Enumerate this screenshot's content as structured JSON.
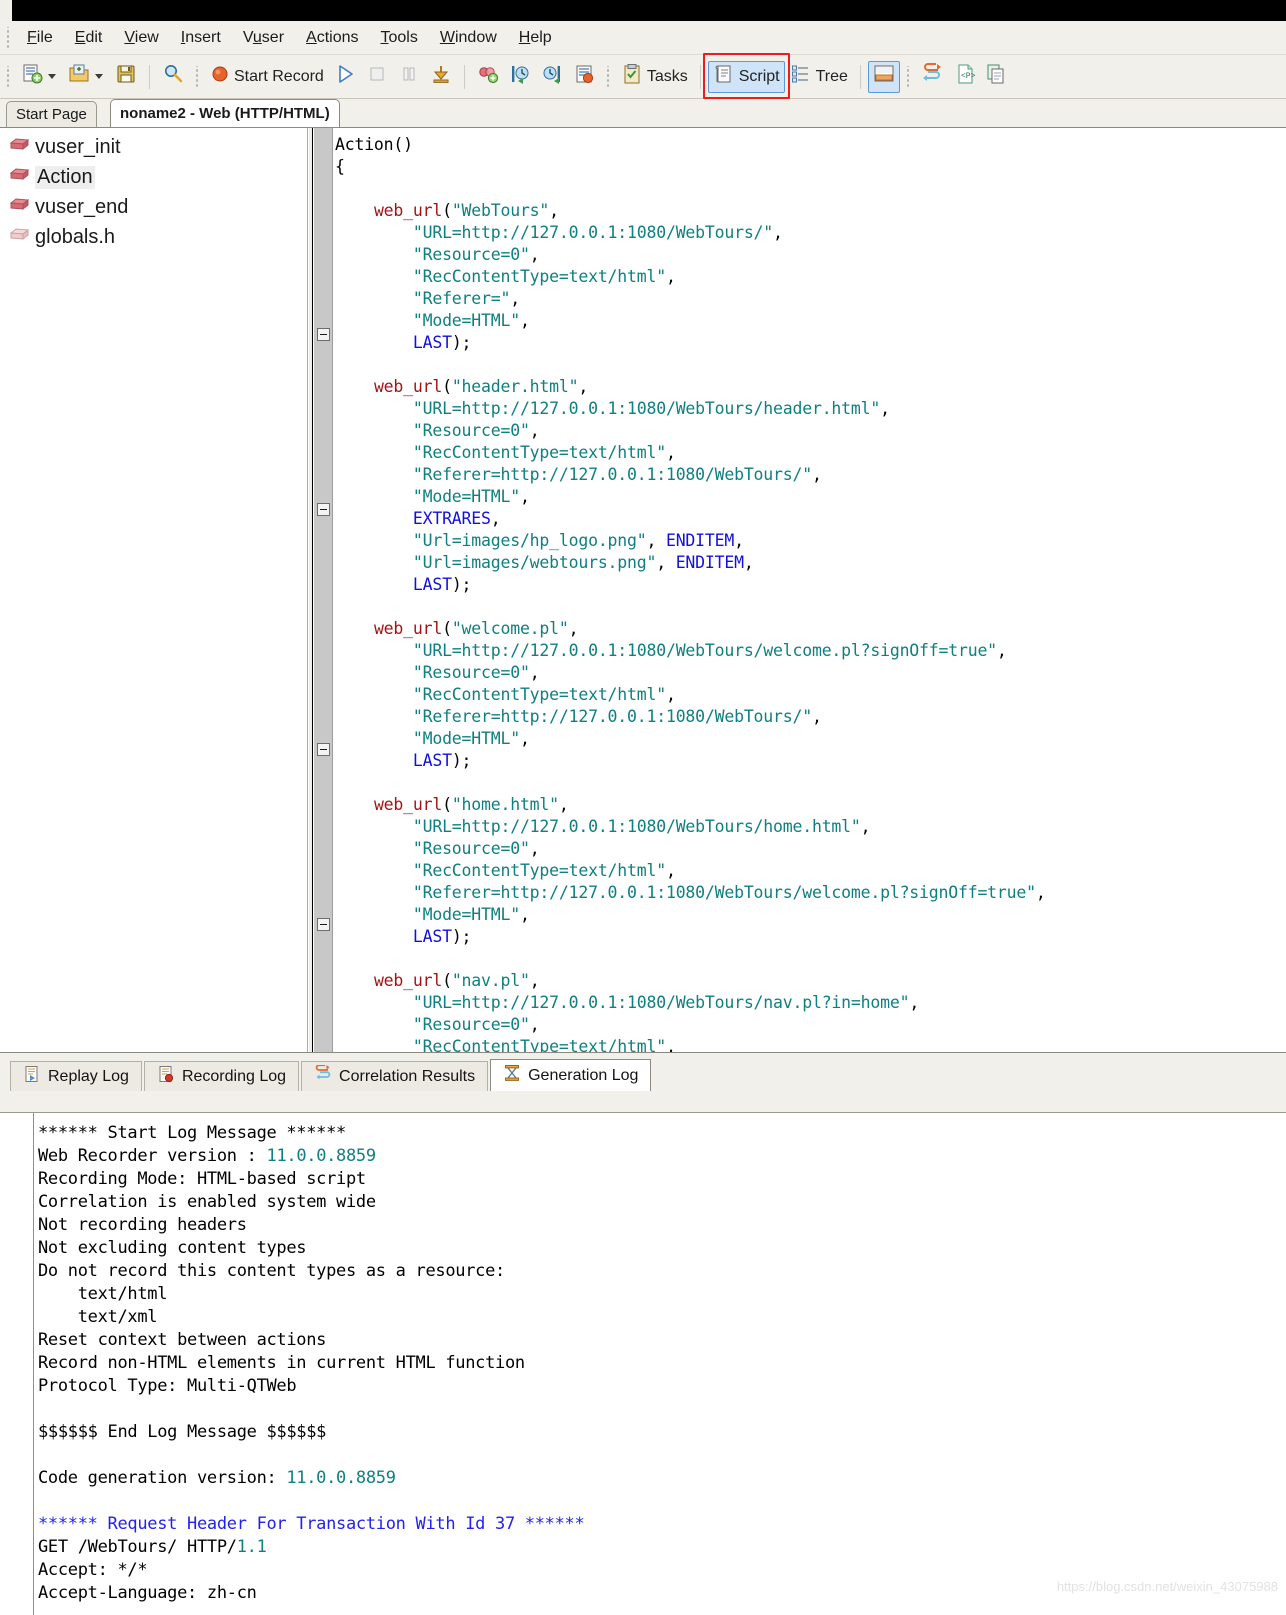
{
  "window": {
    "title_strip": ""
  },
  "menubar": {
    "items": [
      {
        "label": "File",
        "mnemonic": "F"
      },
      {
        "label": "Edit",
        "mnemonic": "E"
      },
      {
        "label": "View",
        "mnemonic": "V"
      },
      {
        "label": "Insert",
        "mnemonic": "I"
      },
      {
        "label": "Vuser",
        "mnemonic": "u"
      },
      {
        "label": "Actions",
        "mnemonic": "A"
      },
      {
        "label": "Tools",
        "mnemonic": "T"
      },
      {
        "label": "Window",
        "mnemonic": "W"
      },
      {
        "label": "Help",
        "mnemonic": "H"
      }
    ]
  },
  "toolbar": {
    "new_vuser": "new-vuser-icon",
    "open": "open-folder-icon",
    "save": "save-disk-icon",
    "find": "find-icon",
    "record_label": "Start Record",
    "run_icon": "run-play-icon",
    "stop_icon": "stop-icon",
    "pause_icon": "pause-icon",
    "download_icon": "download-icon",
    "scan_correlations_icon": "scan-correlations-icon",
    "prev_step_icon": "previous-step-icon",
    "next_step_icon": "next-step-icon",
    "runtime_settings_icon": "runtime-settings-icon",
    "tasks_label": "Tasks",
    "script_label": "Script",
    "tree_label": "Tree",
    "split_view_icon": "split-view-icon",
    "swap_icon": "swap-arrows-icon",
    "parameter_icon": "parameter-p-icon",
    "copy_icon": "copy-icon",
    "highlighted_button": "Script",
    "highlight_color": "#ee1c1c"
  },
  "doctabs": [
    {
      "label": "Start Page",
      "active": false
    },
    {
      "label": "noname2 - Web (HTTP/HTML)",
      "active": true
    }
  ],
  "tree": {
    "items": [
      {
        "label": "vuser_init",
        "icon": "action-block-icon",
        "selected": false
      },
      {
        "label": "Action",
        "icon": "action-block-icon",
        "selected": true
      },
      {
        "label": "vuser_end",
        "icon": "action-block-icon",
        "selected": false
      },
      {
        "label": "globals.h",
        "icon": "header-file-icon",
        "selected": false
      }
    ]
  },
  "editor": {
    "lines": [
      [
        {
          "t": "Action()",
          "c": "plain"
        }
      ],
      [
        {
          "t": "{",
          "c": "plain"
        }
      ],
      [],
      [
        {
          "t": "    ",
          "c": "plain"
        },
        {
          "t": "web_url",
          "c": "fn"
        },
        {
          "t": "(",
          "c": "plain"
        },
        {
          "t": "\"WebTours\"",
          "c": "str"
        },
        {
          "t": ",",
          "c": "plain"
        }
      ],
      [
        {
          "t": "        ",
          "c": "plain"
        },
        {
          "t": "\"URL=http://127.0.0.1:1080/WebTours/\"",
          "c": "str"
        },
        {
          "t": ",",
          "c": "plain"
        }
      ],
      [
        {
          "t": "        ",
          "c": "plain"
        },
        {
          "t": "\"Resource=0\"",
          "c": "str"
        },
        {
          "t": ",",
          "c": "plain"
        }
      ],
      [
        {
          "t": "        ",
          "c": "plain"
        },
        {
          "t": "\"RecContentType=text/html\"",
          "c": "str"
        },
        {
          "t": ",",
          "c": "plain"
        }
      ],
      [
        {
          "t": "        ",
          "c": "plain"
        },
        {
          "t": "\"Referer=\"",
          "c": "str"
        },
        {
          "t": ",",
          "c": "plain"
        }
      ],
      [
        {
          "t": "        ",
          "c": "plain"
        },
        {
          "t": "\"Mode=HTML\"",
          "c": "str"
        },
        {
          "t": ",",
          "c": "plain"
        }
      ],
      [
        {
          "t": "        ",
          "c": "plain"
        },
        {
          "t": "LAST",
          "c": "kw"
        },
        {
          "t": ");",
          "c": "plain"
        }
      ],
      [],
      [
        {
          "t": "    ",
          "c": "plain"
        },
        {
          "t": "web_url",
          "c": "fn"
        },
        {
          "t": "(",
          "c": "plain"
        },
        {
          "t": "\"header.html\"",
          "c": "str"
        },
        {
          "t": ",",
          "c": "plain"
        }
      ],
      [
        {
          "t": "        ",
          "c": "plain"
        },
        {
          "t": "\"URL=http://127.0.0.1:1080/WebTours/header.html\"",
          "c": "str"
        },
        {
          "t": ",",
          "c": "plain"
        }
      ],
      [
        {
          "t": "        ",
          "c": "plain"
        },
        {
          "t": "\"Resource=0\"",
          "c": "str"
        },
        {
          "t": ",",
          "c": "plain"
        }
      ],
      [
        {
          "t": "        ",
          "c": "plain"
        },
        {
          "t": "\"RecContentType=text/html\"",
          "c": "str"
        },
        {
          "t": ",",
          "c": "plain"
        }
      ],
      [
        {
          "t": "        ",
          "c": "plain"
        },
        {
          "t": "\"Referer=http://127.0.0.1:1080/WebTours/\"",
          "c": "str"
        },
        {
          "t": ",",
          "c": "plain"
        }
      ],
      [
        {
          "t": "        ",
          "c": "plain"
        },
        {
          "t": "\"Mode=HTML\"",
          "c": "str"
        },
        {
          "t": ",",
          "c": "plain"
        }
      ],
      [
        {
          "t": "        ",
          "c": "plain"
        },
        {
          "t": "EXTRARES",
          "c": "kw"
        },
        {
          "t": ",",
          "c": "plain"
        }
      ],
      [
        {
          "t": "        ",
          "c": "plain"
        },
        {
          "t": "\"Url=images/hp_logo.png\"",
          "c": "str"
        },
        {
          "t": ", ",
          "c": "plain"
        },
        {
          "t": "ENDITEM",
          "c": "kw"
        },
        {
          "t": ",",
          "c": "plain"
        }
      ],
      [
        {
          "t": "        ",
          "c": "plain"
        },
        {
          "t": "\"Url=images/webtours.png\"",
          "c": "str"
        },
        {
          "t": ", ",
          "c": "plain"
        },
        {
          "t": "ENDITEM",
          "c": "kw"
        },
        {
          "t": ",",
          "c": "plain"
        }
      ],
      [
        {
          "t": "        ",
          "c": "plain"
        },
        {
          "t": "LAST",
          "c": "kw"
        },
        {
          "t": ");",
          "c": "plain"
        }
      ],
      [],
      [
        {
          "t": "    ",
          "c": "plain"
        },
        {
          "t": "web_url",
          "c": "fn"
        },
        {
          "t": "(",
          "c": "plain"
        },
        {
          "t": "\"welcome.pl\"",
          "c": "str"
        },
        {
          "t": ",",
          "c": "plain"
        }
      ],
      [
        {
          "t": "        ",
          "c": "plain"
        },
        {
          "t": "\"URL=http://127.0.0.1:1080/WebTours/welcome.pl?signOff=true\"",
          "c": "str"
        },
        {
          "t": ",",
          "c": "plain"
        }
      ],
      [
        {
          "t": "        ",
          "c": "plain"
        },
        {
          "t": "\"Resource=0\"",
          "c": "str"
        },
        {
          "t": ",",
          "c": "plain"
        }
      ],
      [
        {
          "t": "        ",
          "c": "plain"
        },
        {
          "t": "\"RecContentType=text/html\"",
          "c": "str"
        },
        {
          "t": ",",
          "c": "plain"
        }
      ],
      [
        {
          "t": "        ",
          "c": "plain"
        },
        {
          "t": "\"Referer=http://127.0.0.1:1080/WebTours/\"",
          "c": "str"
        },
        {
          "t": ",",
          "c": "plain"
        }
      ],
      [
        {
          "t": "        ",
          "c": "plain"
        },
        {
          "t": "\"Mode=HTML\"",
          "c": "str"
        },
        {
          "t": ",",
          "c": "plain"
        }
      ],
      [
        {
          "t": "        ",
          "c": "plain"
        },
        {
          "t": "LAST",
          "c": "kw"
        },
        {
          "t": ");",
          "c": "plain"
        }
      ],
      [],
      [
        {
          "t": "    ",
          "c": "plain"
        },
        {
          "t": "web_url",
          "c": "fn"
        },
        {
          "t": "(",
          "c": "plain"
        },
        {
          "t": "\"home.html\"",
          "c": "str"
        },
        {
          "t": ",",
          "c": "plain"
        }
      ],
      [
        {
          "t": "        ",
          "c": "plain"
        },
        {
          "t": "\"URL=http://127.0.0.1:1080/WebTours/home.html\"",
          "c": "str"
        },
        {
          "t": ",",
          "c": "plain"
        }
      ],
      [
        {
          "t": "        ",
          "c": "plain"
        },
        {
          "t": "\"Resource=0\"",
          "c": "str"
        },
        {
          "t": ",",
          "c": "plain"
        }
      ],
      [
        {
          "t": "        ",
          "c": "plain"
        },
        {
          "t": "\"RecContentType=text/html\"",
          "c": "str"
        },
        {
          "t": ",",
          "c": "plain"
        }
      ],
      [
        {
          "t": "        ",
          "c": "plain"
        },
        {
          "t": "\"Referer=http://127.0.0.1:1080/WebTours/welcome.pl?signOff=true\"",
          "c": "str"
        },
        {
          "t": ",",
          "c": "plain"
        }
      ],
      [
        {
          "t": "        ",
          "c": "plain"
        },
        {
          "t": "\"Mode=HTML\"",
          "c": "str"
        },
        {
          "t": ",",
          "c": "plain"
        }
      ],
      [
        {
          "t": "        ",
          "c": "plain"
        },
        {
          "t": "LAST",
          "c": "kw"
        },
        {
          "t": ");",
          "c": "plain"
        }
      ],
      [],
      [
        {
          "t": "    ",
          "c": "plain"
        },
        {
          "t": "web_url",
          "c": "fn"
        },
        {
          "t": "(",
          "c": "plain"
        },
        {
          "t": "\"nav.pl\"",
          "c": "str"
        },
        {
          "t": ",",
          "c": "plain"
        }
      ],
      [
        {
          "t": "        ",
          "c": "plain"
        },
        {
          "t": "\"URL=http://127.0.0.1:1080/WebTours/nav.pl?in=home\"",
          "c": "str"
        },
        {
          "t": ",",
          "c": "plain"
        }
      ],
      [
        {
          "t": "        ",
          "c": "plain"
        },
        {
          "t": "\"Resource=0\"",
          "c": "str"
        },
        {
          "t": ",",
          "c": "plain"
        }
      ],
      [
        {
          "t": "        ",
          "c": "plain"
        },
        {
          "t": "\"RecContentType=text/html\"",
          "c": "str"
        },
        {
          "t": ",",
          "c": "plain"
        }
      ]
    ],
    "fold_markers": [
      4,
      12,
      23,
      31,
      39
    ]
  },
  "logtabs": [
    {
      "label": "Replay Log",
      "icon": "replay-log-icon",
      "active": false
    },
    {
      "label": "Recording Log",
      "icon": "recording-log-icon",
      "active": false
    },
    {
      "label": "Correlation Results",
      "icon": "correlation-results-icon",
      "active": false
    },
    {
      "label": "Generation Log",
      "icon": "generation-log-icon",
      "active": true
    }
  ],
  "log": {
    "lines": [
      [
        {
          "t": "****** Start Log Message ******",
          "c": "plain"
        }
      ],
      [
        {
          "t": "Web Recorder version : ",
          "c": "plain"
        },
        {
          "t": "11.0.0.8859",
          "c": "teal"
        }
      ],
      [
        {
          "t": "Recording Mode: HTML-based script",
          "c": "plain"
        }
      ],
      [
        {
          "t": "Correlation is enabled system wide",
          "c": "plain"
        }
      ],
      [
        {
          "t": "Not recording headers",
          "c": "plain"
        }
      ],
      [
        {
          "t": "Not excluding content types",
          "c": "plain"
        }
      ],
      [
        {
          "t": "Do not record this content types as a resource:",
          "c": "plain"
        }
      ],
      [
        {
          "t": "    text/html",
          "c": "plain"
        }
      ],
      [
        {
          "t": "    text/xml",
          "c": "plain"
        }
      ],
      [
        {
          "t": "Reset context between actions",
          "c": "plain"
        }
      ],
      [
        {
          "t": "Record non-HTML elements in current HTML function",
          "c": "plain"
        }
      ],
      [
        {
          "t": "Protocol Type: Multi-QTWeb",
          "c": "plain"
        }
      ],
      [],
      [
        {
          "t": "$$$$$$ End Log Message $$$$$$",
          "c": "plain"
        }
      ],
      [],
      [
        {
          "t": "Code generation version: ",
          "c": "plain"
        },
        {
          "t": "11.0.0.8859",
          "c": "teal"
        }
      ],
      [],
      [
        {
          "t": "****** Request Header For Transaction With Id 37 ******",
          "c": "blue"
        }
      ],
      [
        {
          "t": "GET /WebTours/ HTTP/",
          "c": "plain"
        },
        {
          "t": "1.1",
          "c": "teal"
        }
      ],
      [
        {
          "t": "Accept: */*",
          "c": "plain"
        }
      ],
      [
        {
          "t": "Accept-Language: zh-cn",
          "c": "plain"
        }
      ]
    ]
  },
  "watermark": "https://blog.csdn.net/weixin_43075988"
}
